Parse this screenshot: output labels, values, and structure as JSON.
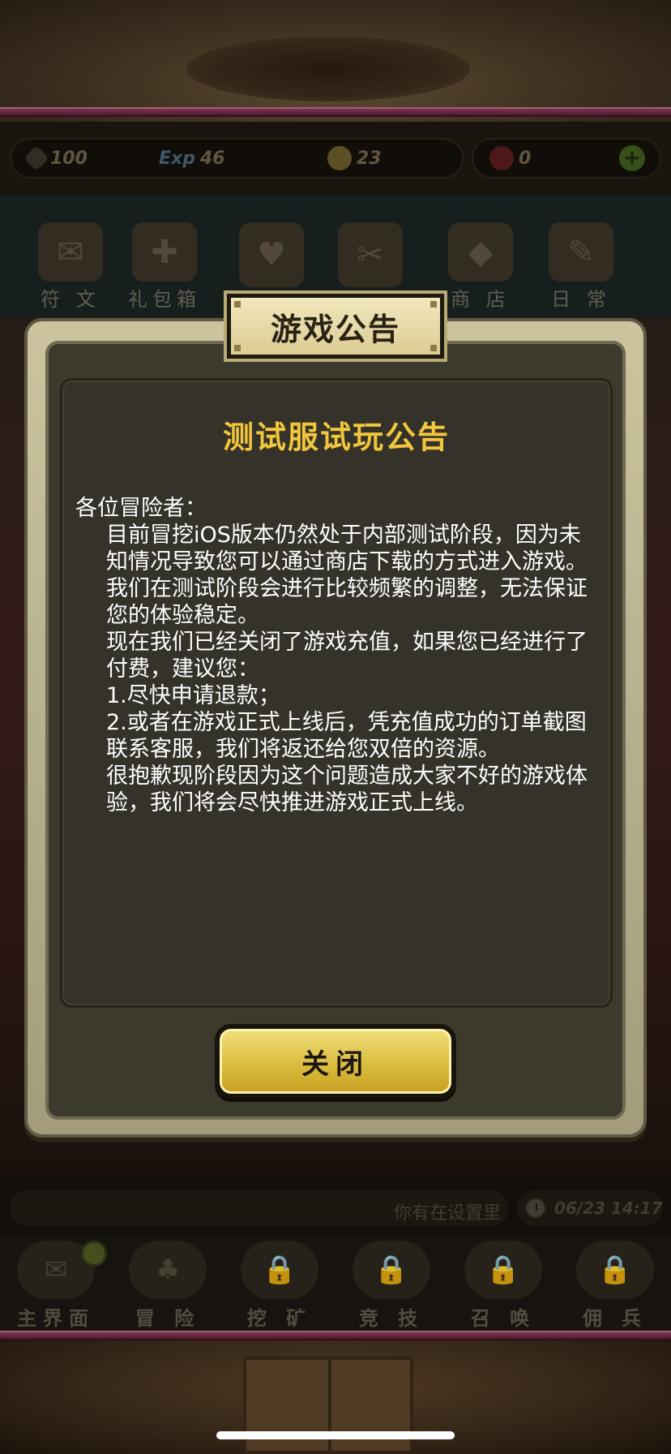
{
  "resources": {
    "pickaxe": "100",
    "exp_label": "Exp",
    "exp": "46",
    "coin": "23",
    "gem": "0",
    "add": "+"
  },
  "top_menu": [
    {
      "label": "符 文",
      "icon": "rune-scroll-icon",
      "glyph": "✉"
    },
    {
      "label": "礼包箱",
      "icon": "gift-box-icon",
      "glyph": "✚"
    },
    {
      "label": "",
      "icon": "handshake-icon",
      "glyph": "♥"
    },
    {
      "label": "",
      "icon": "wrench-icon",
      "glyph": "✂"
    },
    {
      "label": "商 店",
      "icon": "shop-gem-icon",
      "glyph": "◆"
    },
    {
      "label": "日 常",
      "icon": "quest-scroll-icon",
      "glyph": "✎"
    }
  ],
  "dialog": {
    "title": "游戏公告",
    "heading": "测试服试玩公告",
    "lines": [
      "各位冒险者：",
      "目前冒挖iOS版本仍然处于内部测试阶段，因为未知情况导致您可以通过商店下载的方式进入游戏。我们在测试阶段会进行比较频繁的调整，无法保证您的体验稳定。",
      "现在我们已经关闭了游戏充值，如果您已经进行了付费，建议您：",
      "1.尽快申请退款；",
      "2.或者在游戏正式上线后，凭充值成功的订单截图联系客服，我们将返还给您双倍的资源。",
      "很抱歉现阶段因为这个问题造成大家不好的游戏体验，我们将会尽快推进游戏正式上线。"
    ],
    "close_label": "关闭"
  },
  "status": {
    "message": "你有在设置里",
    "time": "06/23 14:17"
  },
  "bottom_nav": [
    {
      "label": "主界面",
      "icon": "map-scroll-icon",
      "glyph": "✉"
    },
    {
      "label": "冒 险",
      "icon": "island-icon",
      "glyph": "♣"
    },
    {
      "label": "挖 矿",
      "icon": "lock-icon",
      "glyph": "🔒"
    },
    {
      "label": "竞 技",
      "icon": "lock-icon",
      "glyph": "🔒"
    },
    {
      "label": "召 唤",
      "icon": "lock-icon",
      "glyph": "🔒"
    },
    {
      "label": "佣 兵",
      "icon": "lock-icon",
      "glyph": "🔒"
    }
  ],
  "colors": {
    "heading": "#f1c63c",
    "button": "#d8ba3a",
    "panel": "#35322a",
    "frame": "#cbc49f"
  }
}
